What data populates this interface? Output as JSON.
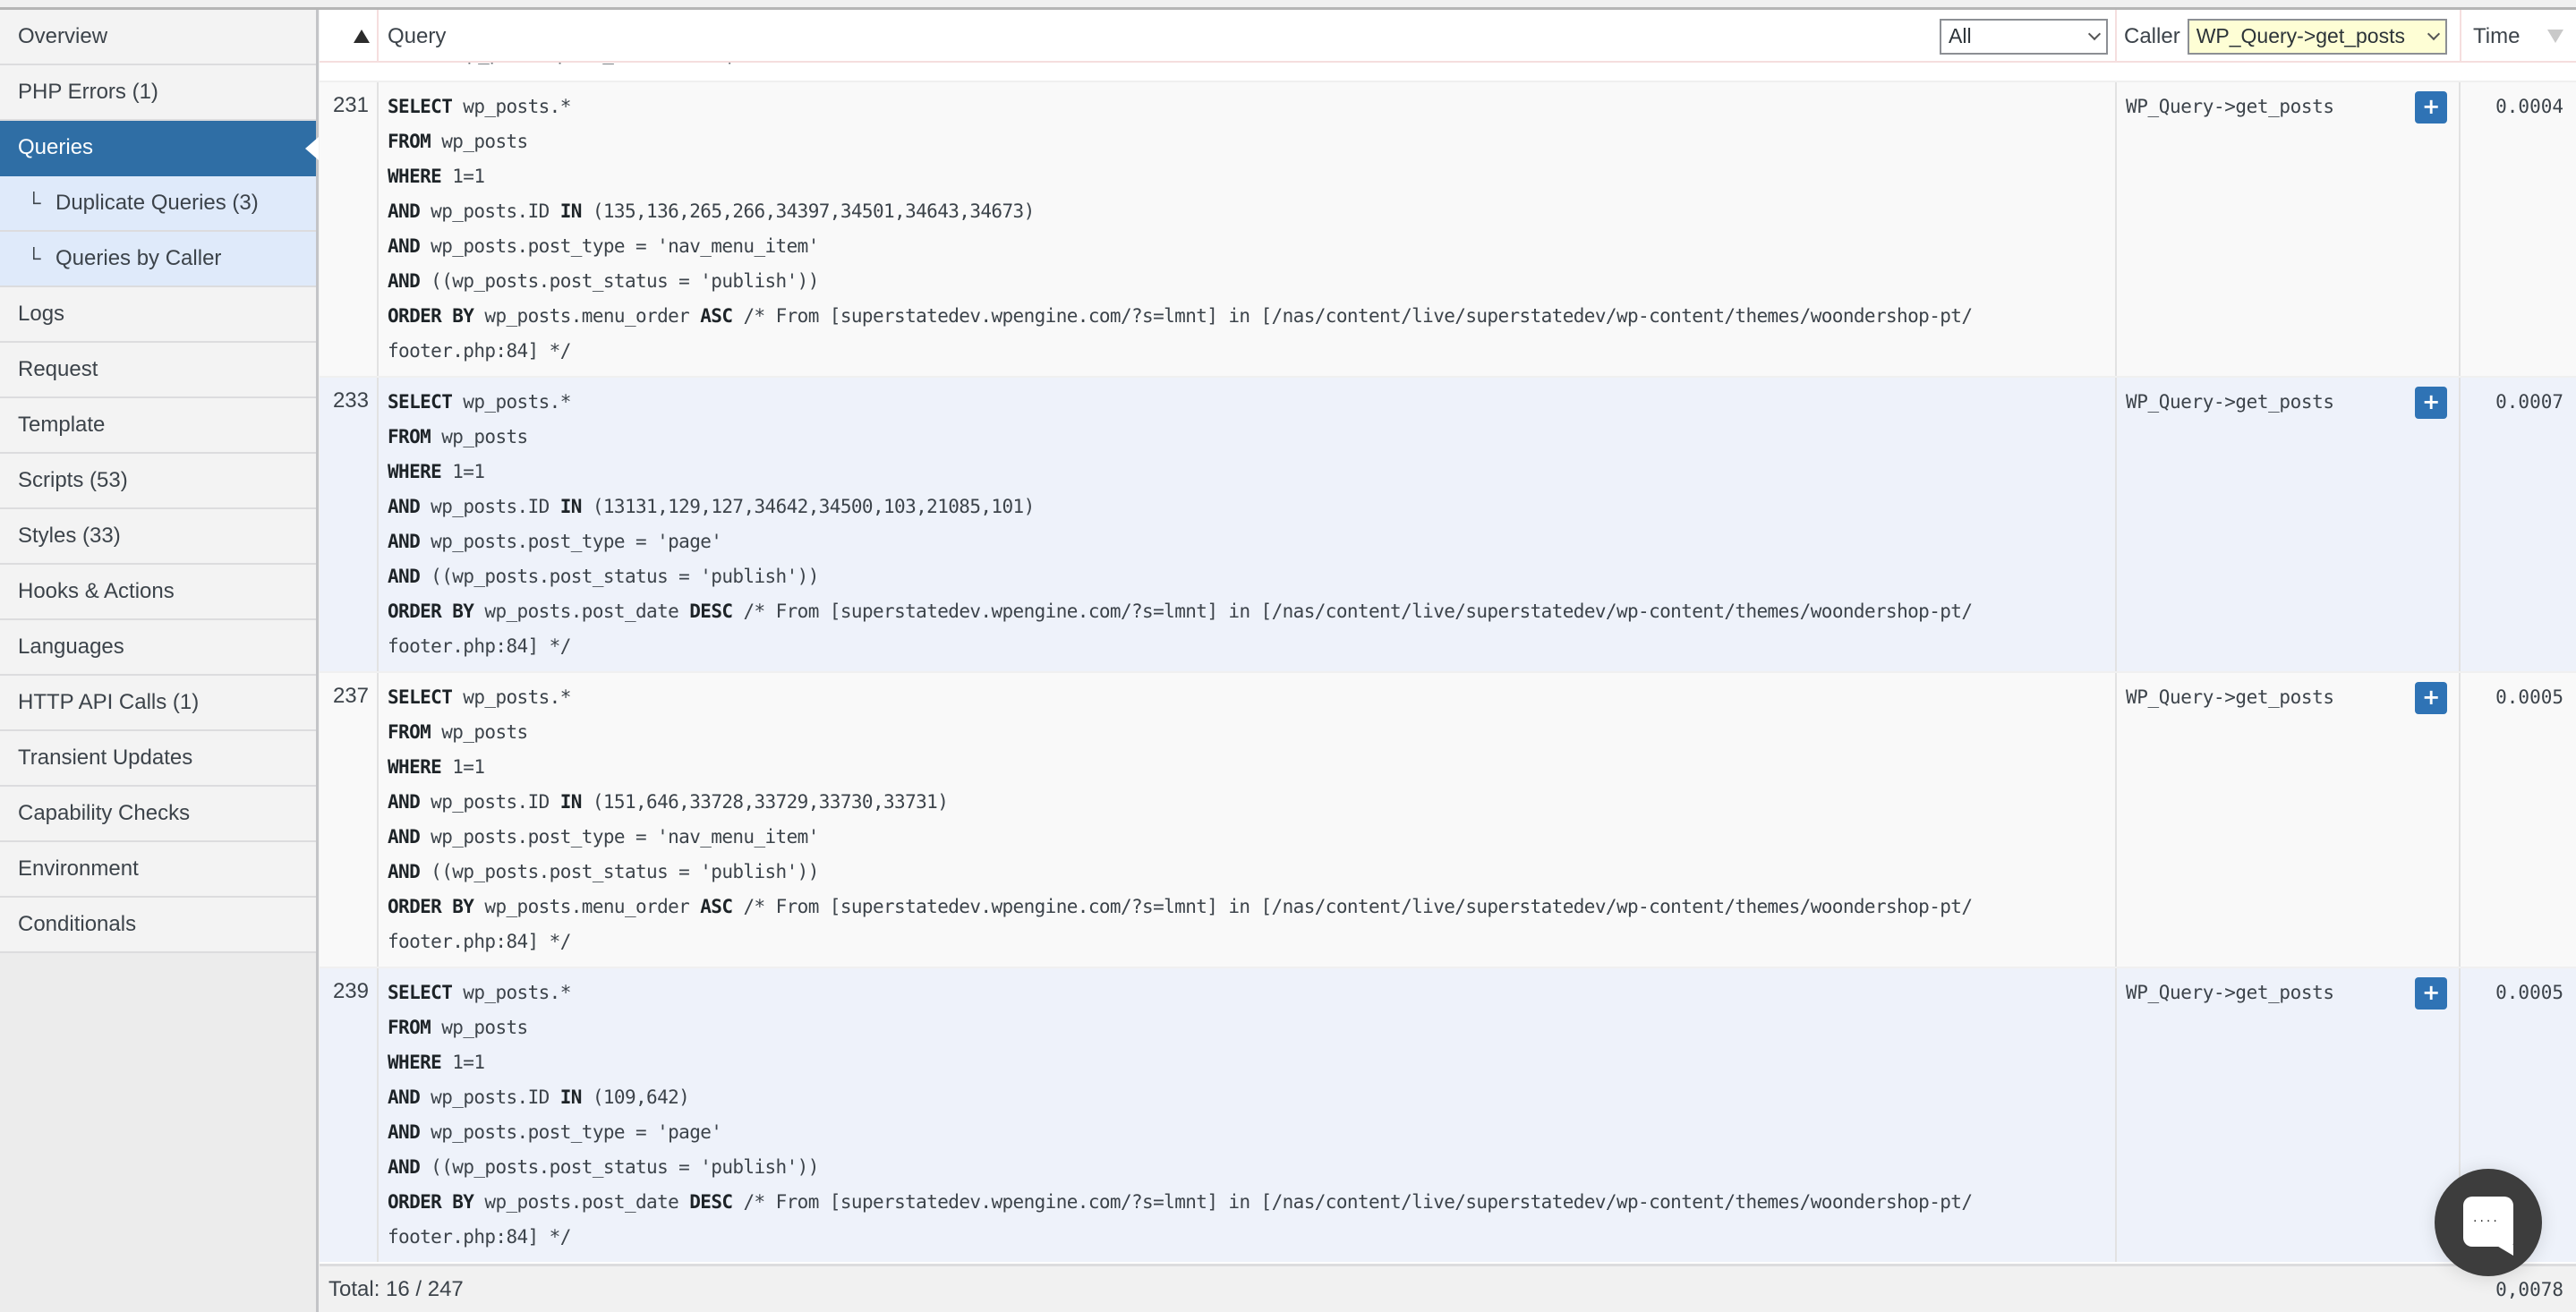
{
  "sidebar": {
    "items": [
      {
        "label": "Overview",
        "type": "item"
      },
      {
        "label": "PHP Errors (1)",
        "type": "item"
      },
      {
        "label": "Queries",
        "type": "active"
      },
      {
        "label": "Duplicate Queries (3)",
        "type": "sub"
      },
      {
        "label": "Queries by Caller",
        "type": "sub"
      },
      {
        "label": "Logs",
        "type": "item"
      },
      {
        "label": "Request",
        "type": "item"
      },
      {
        "label": "Template",
        "type": "item"
      },
      {
        "label": "Scripts (53)",
        "type": "item"
      },
      {
        "label": "Styles (33)",
        "type": "item"
      },
      {
        "label": "Hooks & Actions",
        "type": "item"
      },
      {
        "label": "Languages",
        "type": "item"
      },
      {
        "label": "HTTP API Calls (1)",
        "type": "item"
      },
      {
        "label": "Transient Updates",
        "type": "item"
      },
      {
        "label": "Capability Checks",
        "type": "item"
      },
      {
        "label": "Environment",
        "type": "item"
      },
      {
        "label": "Conditionals",
        "type": "item"
      }
    ],
    "sub_prefix": "└",
    "accent_color": "#2f6ea5"
  },
  "table": {
    "headers": {
      "query": "Query",
      "query_filter": "All",
      "caller": "Caller",
      "caller_filter": "WP_Query->get_posts",
      "time": "Time"
    },
    "ghost_line": "AND ((wp_posts.post_status = 'publish'))",
    "rows": [
      {
        "num": "231",
        "lines": [
          [
            {
              "k": "SELECT"
            },
            {
              "t": " wp_posts.*"
            }
          ],
          [
            {
              "k": "FROM"
            },
            {
              "t": " wp_posts"
            }
          ],
          [
            {
              "k": "WHERE"
            },
            {
              "t": " 1=1"
            }
          ],
          [
            {
              "k": "AND"
            },
            {
              "t": " wp_posts.ID "
            },
            {
              "k": "IN"
            },
            {
              "t": " (135,136,265,266,34397,34501,34643,34673)"
            }
          ],
          [
            {
              "k": "AND"
            },
            {
              "t": " wp_posts.post_type = 'nav_menu_item'"
            }
          ],
          [
            {
              "k": "AND"
            },
            {
              "t": " ((wp_posts.post_status = 'publish'))"
            }
          ],
          [
            {
              "k": "ORDER BY"
            },
            {
              "t": " wp_posts.menu_order "
            },
            {
              "k": "ASC"
            },
            {
              "t": " /* From [superstatedev.wpengine.com/?s=lmnt] in [/nas/content/live/superstatedev/wp-content/themes/woondershop-pt/"
            }
          ],
          [
            {
              "t": "footer.php:84] */"
            }
          ]
        ],
        "caller": "WP_Query->get_posts",
        "time": "0.0004"
      },
      {
        "num": "233",
        "lines": [
          [
            {
              "k": "SELECT"
            },
            {
              "t": " wp_posts.*"
            }
          ],
          [
            {
              "k": "FROM"
            },
            {
              "t": " wp_posts"
            }
          ],
          [
            {
              "k": "WHERE"
            },
            {
              "t": " 1=1"
            }
          ],
          [
            {
              "k": "AND"
            },
            {
              "t": " wp_posts.ID "
            },
            {
              "k": "IN"
            },
            {
              "t": " (13131,129,127,34642,34500,103,21085,101)"
            }
          ],
          [
            {
              "k": "AND"
            },
            {
              "t": " wp_posts.post_type = 'page'"
            }
          ],
          [
            {
              "k": "AND"
            },
            {
              "t": " ((wp_posts.post_status = 'publish'))"
            }
          ],
          [
            {
              "k": "ORDER BY"
            },
            {
              "t": " wp_posts.post_date "
            },
            {
              "k": "DESC"
            },
            {
              "t": " /* From [superstatedev.wpengine.com/?s=lmnt] in [/nas/content/live/superstatedev/wp-content/themes/woondershop-pt/"
            }
          ],
          [
            {
              "t": "footer.php:84] */"
            }
          ]
        ],
        "caller": "WP_Query->get_posts",
        "time": "0.0007"
      },
      {
        "num": "237",
        "lines": [
          [
            {
              "k": "SELECT"
            },
            {
              "t": " wp_posts.*"
            }
          ],
          [
            {
              "k": "FROM"
            },
            {
              "t": " wp_posts"
            }
          ],
          [
            {
              "k": "WHERE"
            },
            {
              "t": " 1=1"
            }
          ],
          [
            {
              "k": "AND"
            },
            {
              "t": " wp_posts.ID "
            },
            {
              "k": "IN"
            },
            {
              "t": " (151,646,33728,33729,33730,33731)"
            }
          ],
          [
            {
              "k": "AND"
            },
            {
              "t": " wp_posts.post_type = 'nav_menu_item'"
            }
          ],
          [
            {
              "k": "AND"
            },
            {
              "t": " ((wp_posts.post_status = 'publish'))"
            }
          ],
          [
            {
              "k": "ORDER BY"
            },
            {
              "t": " wp_posts.menu_order "
            },
            {
              "k": "ASC"
            },
            {
              "t": " /* From [superstatedev.wpengine.com/?s=lmnt] in [/nas/content/live/superstatedev/wp-content/themes/woondershop-pt/"
            }
          ],
          [
            {
              "t": "footer.php:84] */"
            }
          ]
        ],
        "caller": "WP_Query->get_posts",
        "time": "0.0005"
      },
      {
        "num": "239",
        "lines": [
          [
            {
              "k": "SELECT"
            },
            {
              "t": " wp_posts.*"
            }
          ],
          [
            {
              "k": "FROM"
            },
            {
              "t": " wp_posts"
            }
          ],
          [
            {
              "k": "WHERE"
            },
            {
              "t": " 1=1"
            }
          ],
          [
            {
              "k": "AND"
            },
            {
              "t": " wp_posts.ID "
            },
            {
              "k": "IN"
            },
            {
              "t": " (109,642)"
            }
          ],
          [
            {
              "k": "AND"
            },
            {
              "t": " wp_posts.post_type = 'page'"
            }
          ],
          [
            {
              "k": "AND"
            },
            {
              "t": " ((wp_posts.post_status = 'publish'))"
            }
          ],
          [
            {
              "k": "ORDER BY"
            },
            {
              "t": " wp_posts.post_date "
            },
            {
              "k": "DESC"
            },
            {
              "t": " /* From [superstatedev.wpengine.com/?s=lmnt] in [/nas/content/live/superstatedev/wp-content/themes/woondershop-pt/"
            }
          ],
          [
            {
              "t": "footer.php:84] */"
            }
          ]
        ],
        "caller": "WP_Query->get_posts",
        "time": "0.0005"
      }
    ],
    "expand_label": "+",
    "footer": {
      "total": "Total: 16 / 247",
      "total_time": "0,0078"
    }
  },
  "chat": {
    "icon": "chat-bubble-icon",
    "dots": "····"
  },
  "colors": {
    "accent": "#2f6ea5",
    "button": "#2f73b5",
    "caller_filter_bg": "#fefed5",
    "row_alt": "#eef2fa"
  }
}
